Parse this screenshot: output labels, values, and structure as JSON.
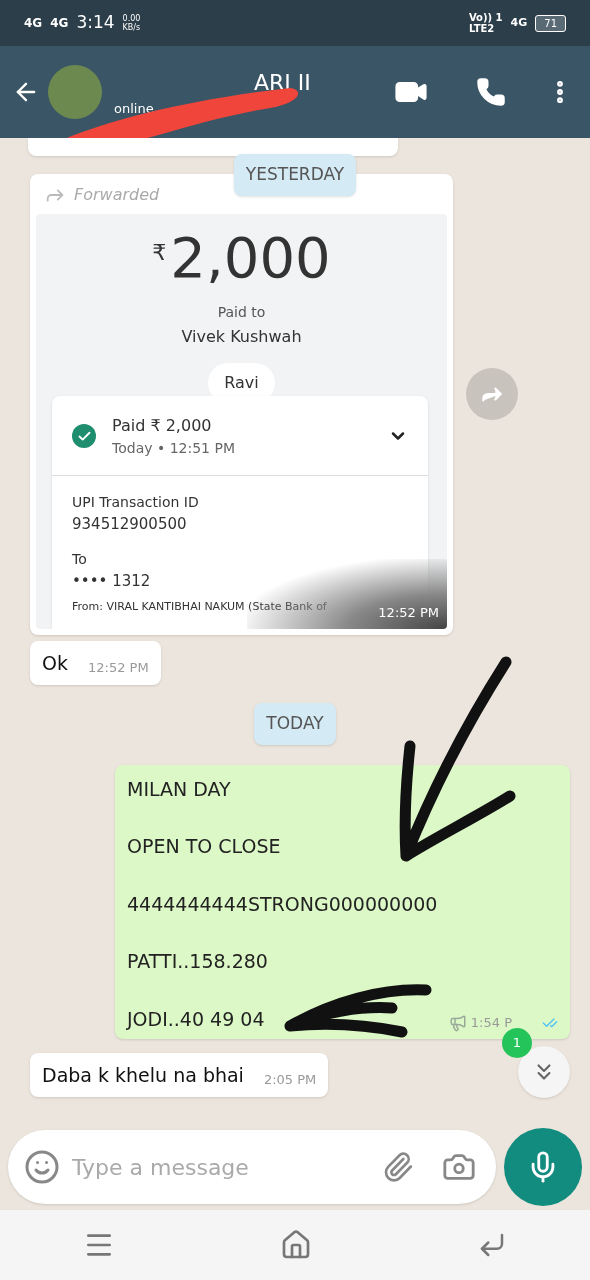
{
  "status_bar": {
    "network_1": "4G",
    "network_2": "4G",
    "time": "3:14",
    "speed": "0.00",
    "speed_unit": "KB/s",
    "volte": "Vo)) 1",
    "lte": "LTE2",
    "network_3": "4G",
    "battery": "71"
  },
  "header": {
    "name": "ARI II",
    "status": "online"
  },
  "messages": [
    {
      "kind": "date",
      "text": "YESTERDAY"
    },
    {
      "kind": "image",
      "forwarded_label": "Forwarded",
      "time": "12:52 PM",
      "receipt": {
        "currency": "₹",
        "amount": "2,000",
        "paid_to_label": "Paid to",
        "payee": "Vivek Kushwah",
        "chip": "Ravi",
        "status": "Paid ₹ 2,000",
        "when": "Today • 12:51 PM",
        "id_label": "UPI Transaction ID",
        "id": "934512900500",
        "to_label": "To",
        "to_value": "•••• 1312",
        "from": "From: VIRAL KANTIBHAI NAKUM (State Bank of"
      }
    },
    {
      "kind": "incoming",
      "text": "Ok",
      "time": "12:52 PM"
    },
    {
      "kind": "date",
      "text": "TODAY"
    },
    {
      "kind": "outgoing",
      "lines": [
        "MILAN DAY",
        "OPEN TO CLOSE",
        "4444444444STRONG000000000",
        "PATTI..158.280",
        "JODI..40 49 04"
      ],
      "time": "1:54 P"
    },
    {
      "kind": "incoming",
      "text": "Daba k khelu na bhai",
      "time": "2:05 PM"
    }
  ],
  "scroll_button": {
    "badge": "1"
  },
  "composer": {
    "placeholder": "Type a message"
  }
}
